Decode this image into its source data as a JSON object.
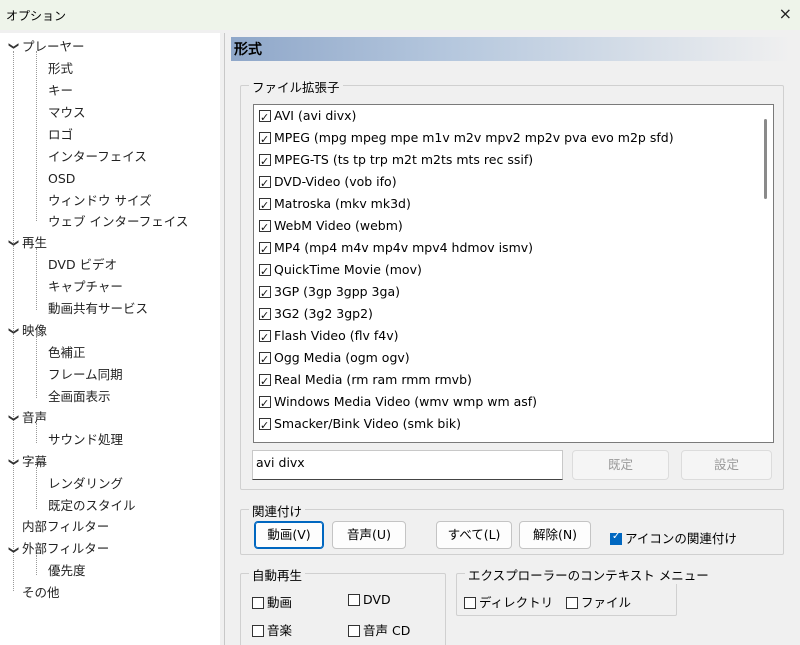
{
  "window": {
    "title": "オプション",
    "close_glyph": "×"
  },
  "tree": {
    "player": "プレーヤー",
    "format": "形式",
    "keys": "キー",
    "mouse": "マウス",
    "logo": "ロゴ",
    "interface": "インターフェイス",
    "osd": "OSD",
    "window_size": "ウィンドウ サイズ",
    "web_interface": "ウェブ インターフェイス",
    "playback": "再生",
    "dvd_video": "DVD ビデオ",
    "capture": "キャプチャー",
    "video_sharing": "動画共有サービス",
    "video": "映像",
    "color_correction": "色補正",
    "frame_sync": "フレーム同期",
    "fullscreen": "全画面表示",
    "audio": "音声",
    "sound_processing": "サウンド処理",
    "subtitles": "字幕",
    "rendering": "レンダリング",
    "default_style": "既定のスタイル",
    "internal_filters": "内部フィルター",
    "external_filters": "外部フィルター",
    "priority": "優先度",
    "other": "その他"
  },
  "header": {
    "title": "形式"
  },
  "extensions": {
    "group_label": "ファイル拡張子",
    "items": [
      "AVI (avi divx)",
      "MPEG (mpg mpeg mpe m1v m2v mpv2 mp2v pva evo m2p sfd)",
      "MPEG-TS (ts tp trp m2t m2ts mts rec ssif)",
      "DVD-Video (vob ifo)",
      "Matroska (mkv mk3d)",
      "WebM Video (webm)",
      "MP4 (mp4 m4v mp4v mpv4 hdmov ismv)",
      "QuickTime Movie (mov)",
      "3GP (3gp 3gpp 3ga)",
      "3G2 (3g2 3gp2)",
      "Flash Video (flv f4v)",
      "Ogg Media (ogm ogv)",
      "Real Media (rm ram rmm rmvb)",
      "Windows Media Video (wmv wmp wm asf)",
      "Smacker/Bink Video (smk bik)"
    ],
    "input_value": "avi divx",
    "default_button": "既定",
    "set_button": "設定"
  },
  "association": {
    "group_label": "関連付け",
    "video_button": "動画(V)",
    "audio_button": "音声(U)",
    "all_button": "すべて(L)",
    "remove_button": "解除(N)",
    "icon_assoc_label": "アイコンの関連付け"
  },
  "autoplay": {
    "group_label": "自動再生",
    "video": "動画",
    "dvd": "DVD",
    "music": "音楽",
    "audio_cd": "音声 CD"
  },
  "explorer": {
    "group_label": "エクスプローラーのコンテキスト メニュー",
    "directory": "ディレクトリ",
    "file": "ファイル"
  }
}
